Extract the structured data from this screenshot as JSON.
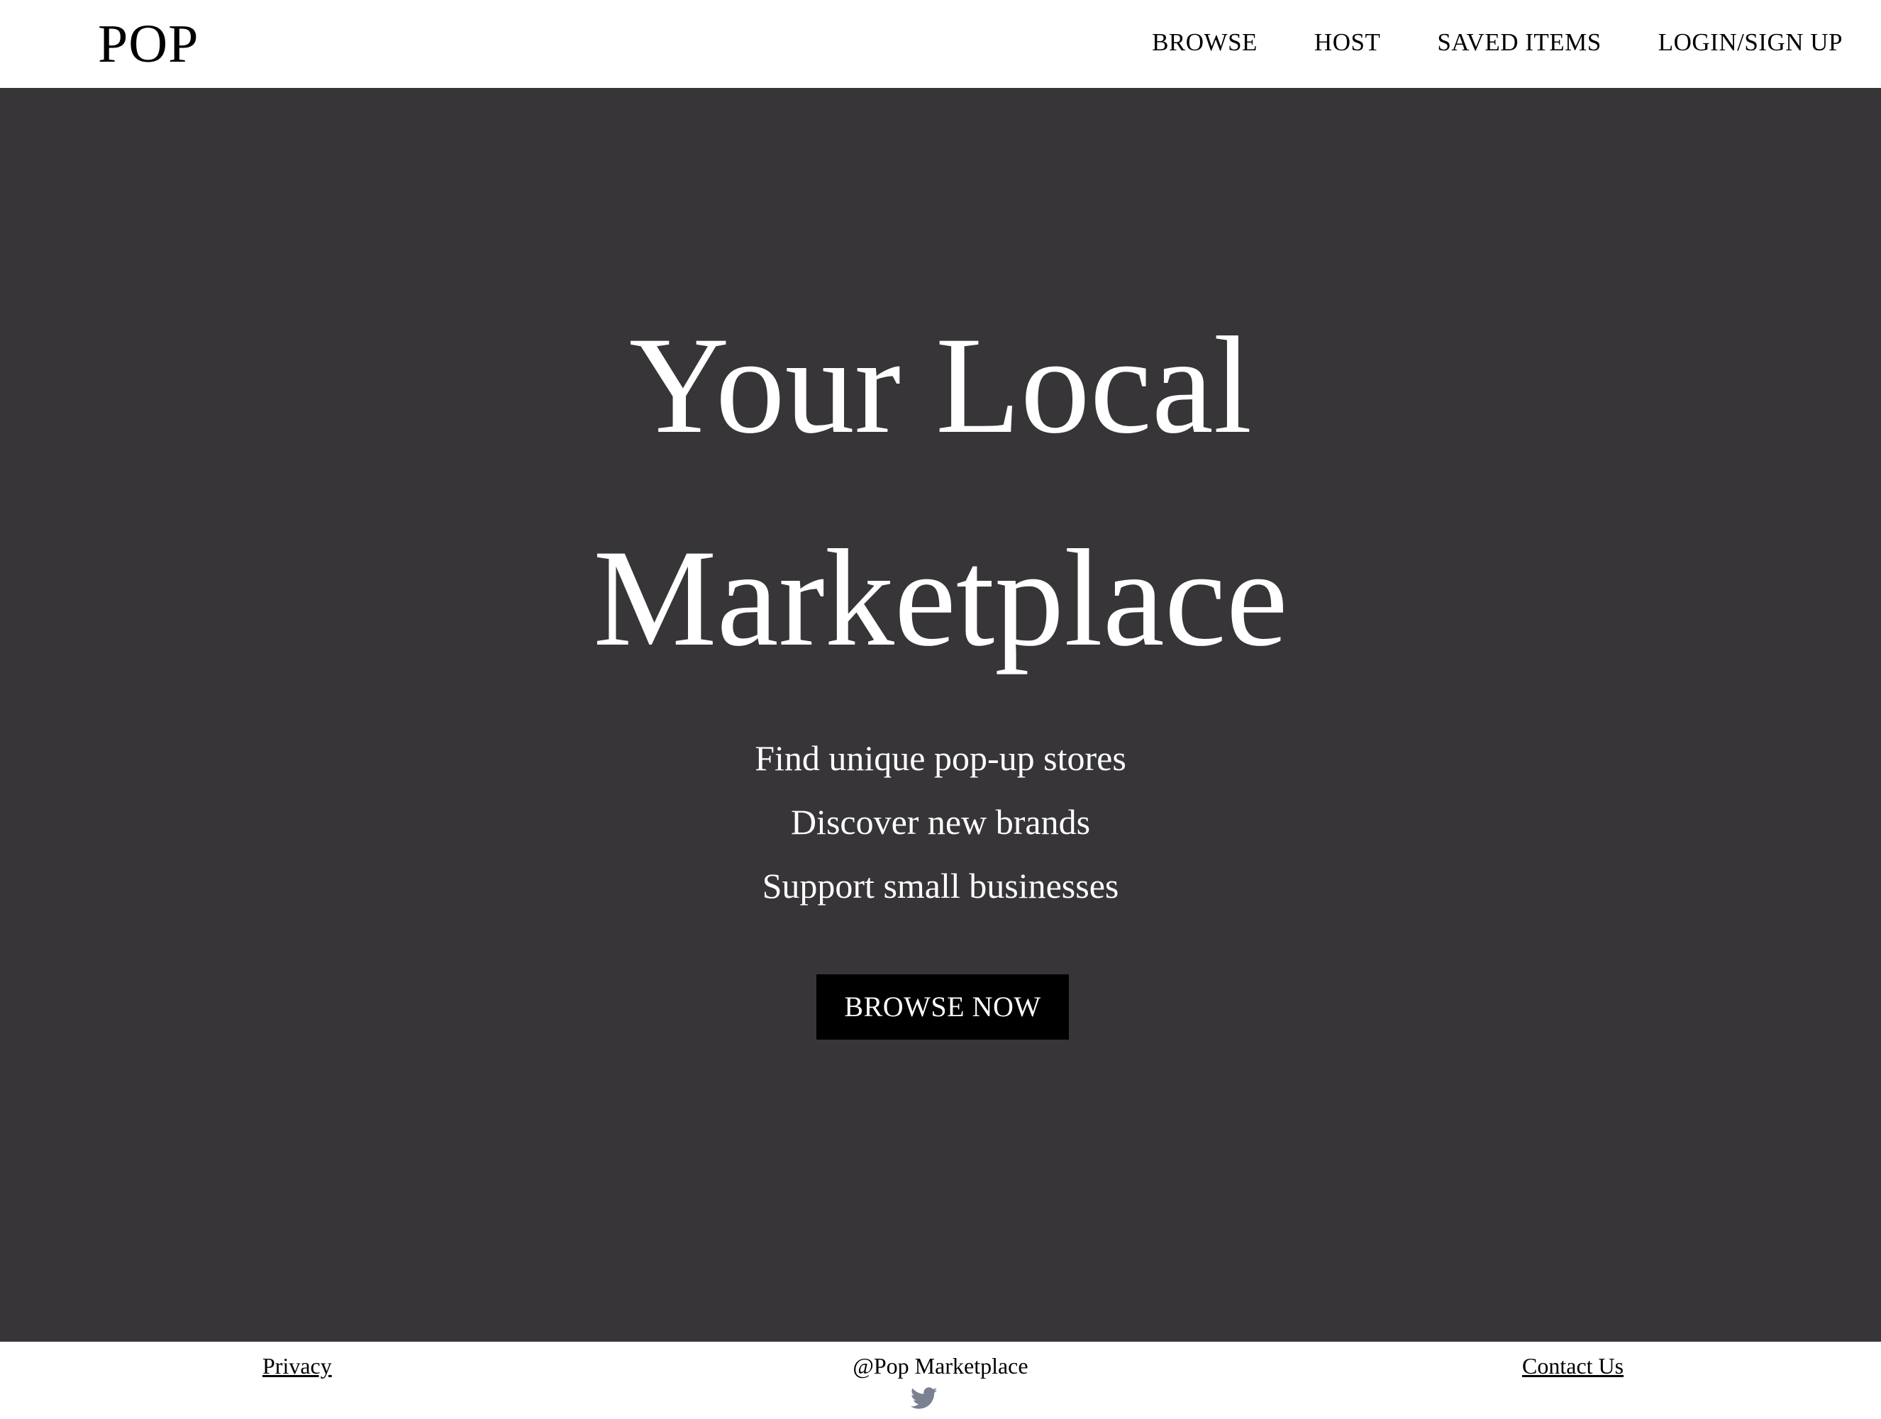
{
  "header": {
    "logo": "POP",
    "nav": [
      {
        "label": "BROWSE"
      },
      {
        "label": "HOST"
      },
      {
        "label": "SAVED ITEMS"
      },
      {
        "label": "LOGIN/SIGN UP"
      }
    ]
  },
  "hero": {
    "title_line1": "Your Local",
    "title_line2": "Marketplace",
    "taglines": [
      "Find unique pop-up stores",
      "Discover new brands",
      "Support small businesses"
    ],
    "cta_label": "BROWSE NOW",
    "background": "#373538"
  },
  "footer": {
    "privacy": "Privacy",
    "copyright": "@Pop Marketplace",
    "contact": "Contact Us",
    "social_icon": "twitter-icon",
    "icon_color": "#7a8190"
  }
}
